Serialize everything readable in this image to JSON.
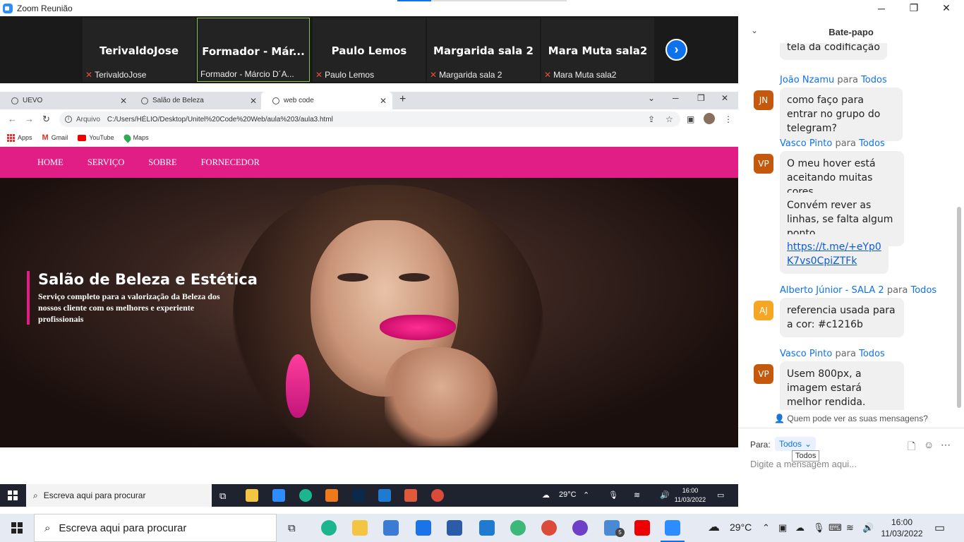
{
  "zoom": {
    "title": "Zoom Reunião",
    "minimize": "─",
    "restore": "❐",
    "close": "✕"
  },
  "participants": [
    {
      "name": "TerivaldoJose",
      "label": "TerivaldoJose"
    },
    {
      "name": "Formador - Már...",
      "label": "Formador - Márcio D´A..."
    },
    {
      "name": "Paulo Lemos",
      "label": "Paulo Lemos"
    },
    {
      "name": "Margarida sala 2",
      "label": "Margarida sala 2"
    },
    {
      "name": "Mara Muta sala2",
      "label": "Mara Muta sala2"
    }
  ],
  "next_arrow": "›",
  "browser": {
    "tabs": [
      {
        "title": "UEVO"
      },
      {
        "title": "Salão de Beleza"
      },
      {
        "title": "web code"
      }
    ],
    "newtab": "+",
    "tab_close": "✕",
    "address_scheme": "Arquivo",
    "address_url": "C:/Users/HÉLIO/Desktop/Unitel%20Code%20Web/aula%203/aula3.html",
    "bookmarks": [
      "Apps",
      "Gmail",
      "YouTube",
      "Maps"
    ]
  },
  "webpage": {
    "nav": [
      "HOME",
      "SERVIÇO",
      "SOBRE",
      "FORNECEDOR"
    ],
    "hero_title": "Salão de Beleza e Estética",
    "hero_subtitle": "Serviço completo para a valorização da Beleza dos nossos cliente com os melhores e experiente profissionais"
  },
  "inner_taskbar": {
    "search_placeholder": "Escreva aqui para procurar",
    "temp": "29°C",
    "time": "16:00",
    "date": "11/03/2022"
  },
  "chat": {
    "title": "Bate-papo",
    "partial_top": "tela da codificação",
    "messages": [
      {
        "initials": "JN",
        "sender": "João Nzamu",
        "to": "Todos",
        "color": "#c4580d",
        "texts": [
          "como faço para entrar no grupo do telegram?"
        ]
      },
      {
        "initials": "VP",
        "sender": "Vasco Pinto",
        "to": "Todos",
        "color": "#c4580d",
        "texts": [
          "O meu hover está aceitando muitas cores.",
          "Convém rever as linhas, se falta algum ponto.",
          "https://t.me/+eYp0K7vs0CpiZTFk"
        ]
      },
      {
        "initials": "AJ",
        "sender": "Alberto Júnior - SALA 2",
        "to": "Todos",
        "color": "#f5a623",
        "texts": [
          "referencia usada para a cor: #c1216b"
        ]
      },
      {
        "initials": "VP",
        "sender": "Vasco Pinto",
        "to": "Todos",
        "color": "#c4580d",
        "texts": [
          "Usem 800px, a imagem estará melhor rendida."
        ]
      }
    ],
    "para_word": "para",
    "who_can_see": "Quem pode ver as suas mensagens?",
    "para_label": "Para:",
    "para_value": "Todos",
    "tooltip": "Todos",
    "input_placeholder": "Digite a mensagem aqui..."
  },
  "taskbar": {
    "search_placeholder": "Escreva aqui para procurar",
    "temp": "29°C",
    "time": "16:00",
    "date": "11/03/2022",
    "badge": "5"
  }
}
